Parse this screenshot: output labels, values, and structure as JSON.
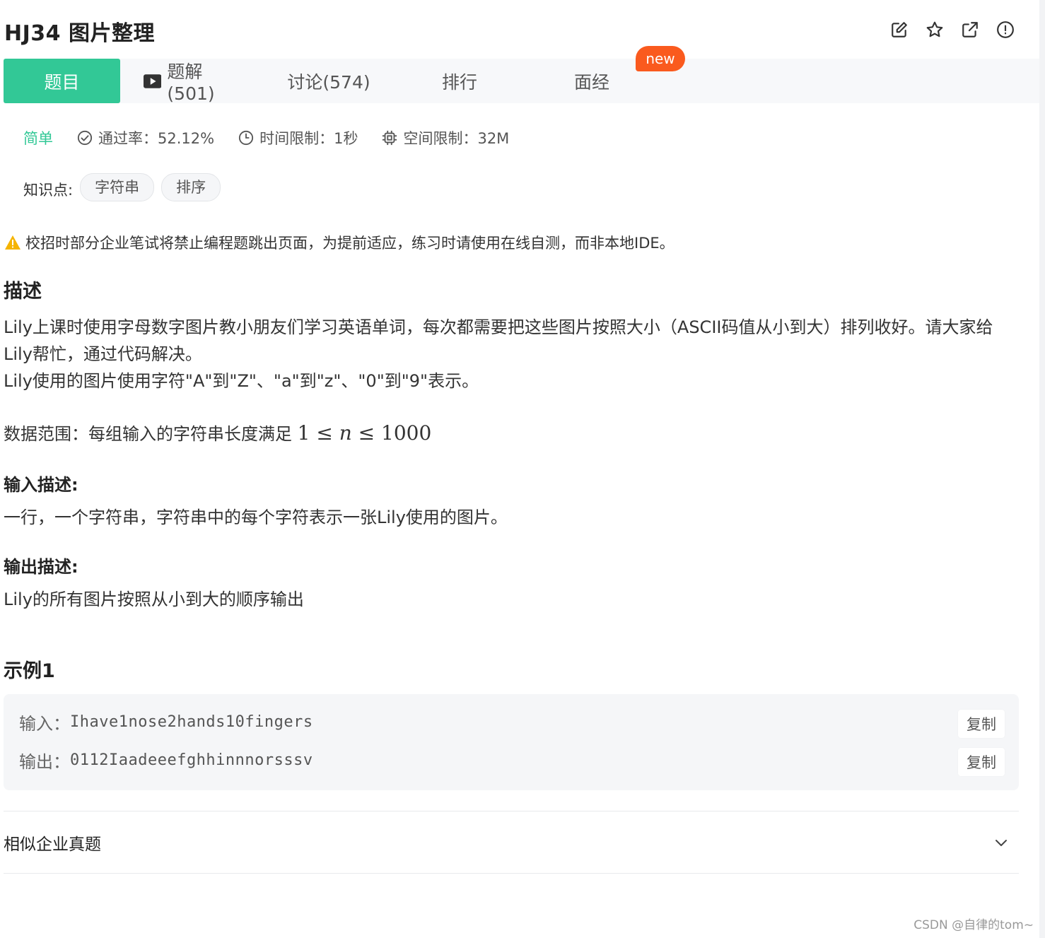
{
  "header": {
    "title": "HJ34  图片整理"
  },
  "tabs": [
    {
      "label": "题目"
    },
    {
      "label": "题解(501)"
    },
    {
      "label": "讨论(574)"
    },
    {
      "label": "排行"
    },
    {
      "label": "面经"
    }
  ],
  "new_badge": "new",
  "meta": {
    "difficulty": "简单",
    "pass_rate": "通过率：52.12%",
    "time_limit": "时间限制：1秒",
    "space_limit": "空间限制：32M"
  },
  "knowledge": {
    "label": "知识点:",
    "tags": [
      "字符串",
      "排序"
    ]
  },
  "warning": "校招时部分企业笔试将禁止编程题跳出页面，为提前适应，练习时请使用在线自测，而非本地IDE。",
  "description": {
    "heading": "描述",
    "line1": "Lily上课时使用字母数字图片教小朋友们学习英语单词，每次都需要把这些图片按照大小（ASCII码值从小到大）排列收好。请大家给Lily帮忙，通过代码解决。",
    "line2": "Lily使用的图片使用字符\"A\"到\"Z\"、\"a\"到\"z\"、\"0\"到\"9\"表示。",
    "range_prefix": "数据范围：每组输入的字符串长度满足 ",
    "range_math_low": "1",
    "range_math_var": "n",
    "range_math_high": "1000"
  },
  "input_desc": {
    "heading": "输入描述:",
    "text": "一行，一个字符串，字符串中的每个字符表示一张Lily使用的图片。"
  },
  "output_desc": {
    "heading": "输出描述:",
    "text": "Lily的所有图片按照从小到大的顺序输出"
  },
  "example": {
    "heading": "示例1",
    "input_label": "输入：",
    "input_value": "Ihave1nose2hands10fingers",
    "output_label": "输出：",
    "output_value": "0112Iaadeeefghhinnnorsssv",
    "copy_label": "复制"
  },
  "similar": {
    "label": "相似企业真题"
  },
  "watermark": "CSDN @自律的tom~",
  "colors": {
    "accent": "#32c896",
    "badge": "#fa5a1e",
    "warning": "#f5b400"
  }
}
